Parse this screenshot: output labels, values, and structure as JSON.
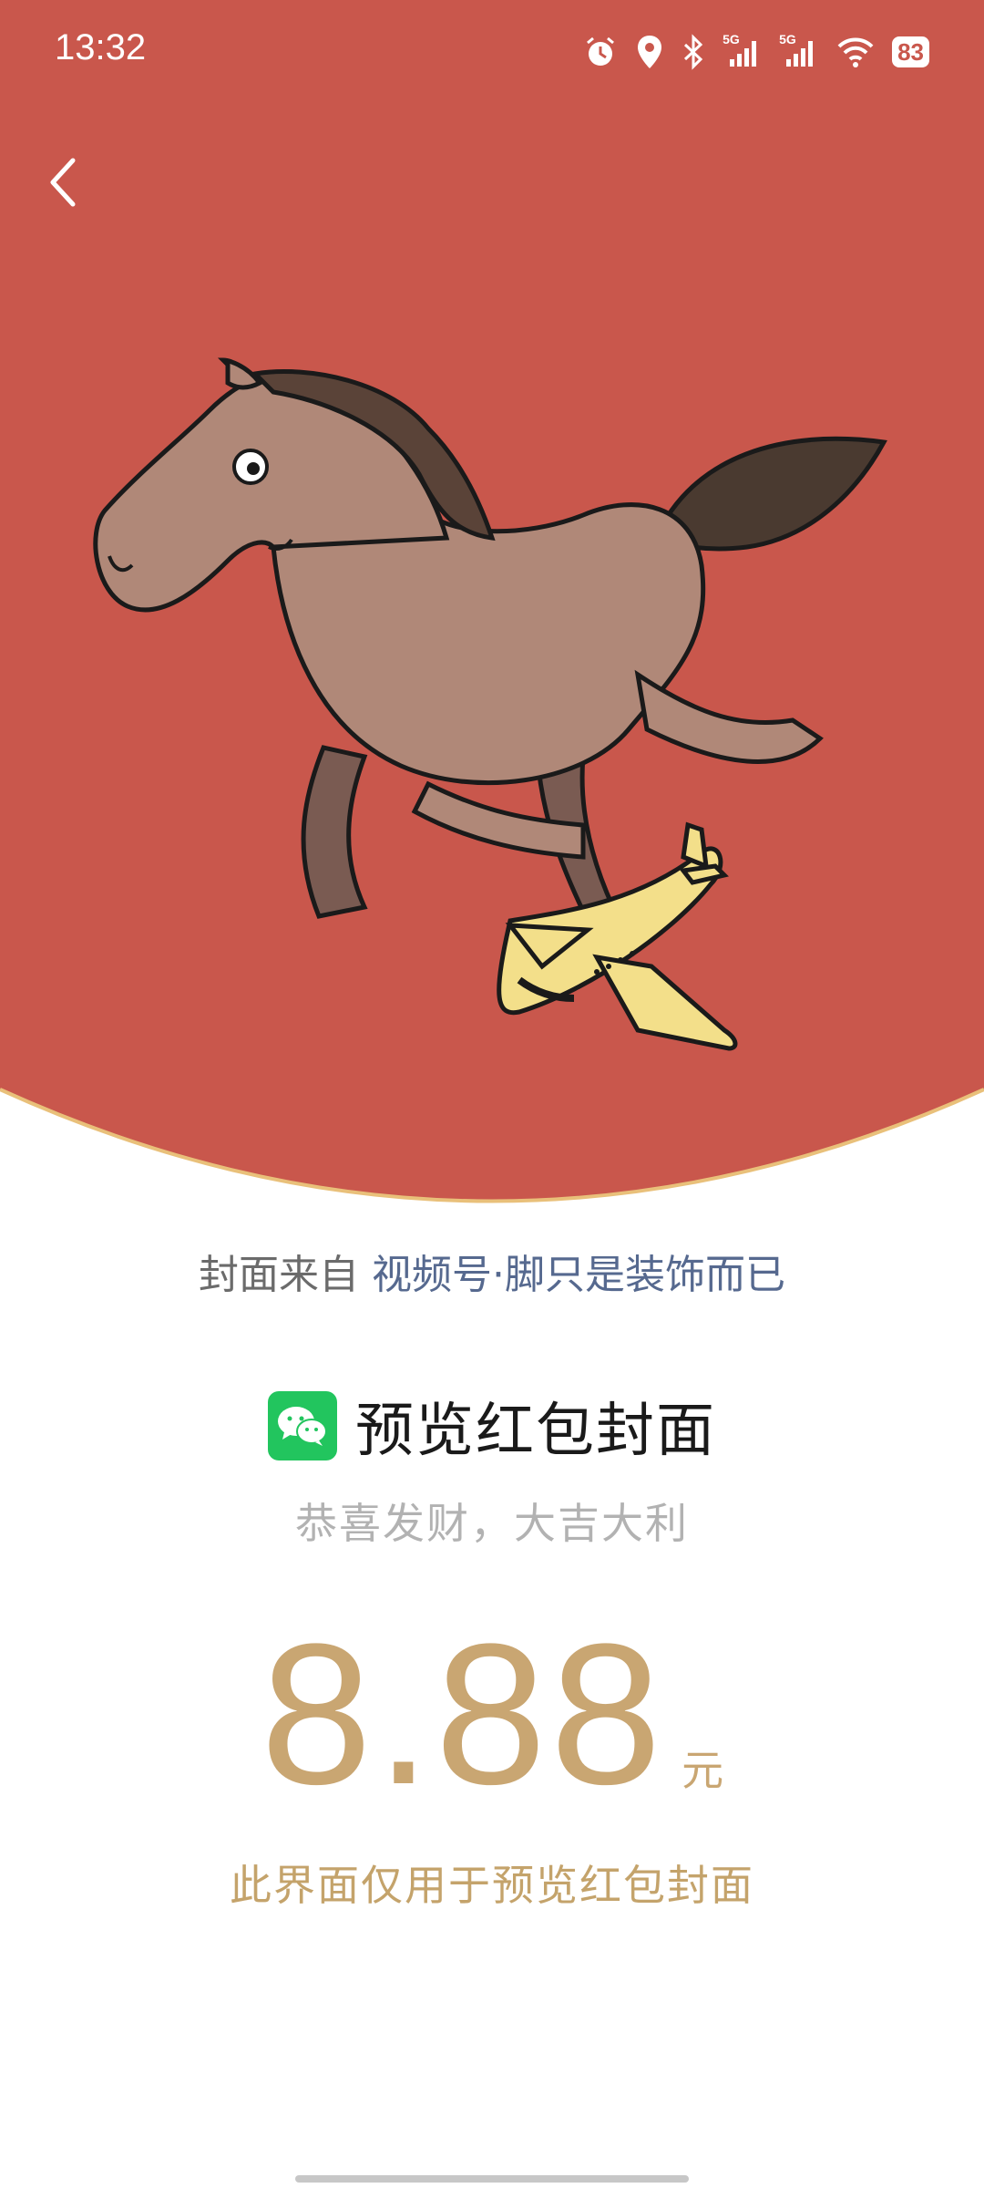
{
  "status_bar": {
    "time": "13:32",
    "battery": "83",
    "signal_1_label": "5G",
    "signal_2_label": "5G"
  },
  "cover": {
    "background_color": "#c9574c",
    "rim_color": "#e9c07a",
    "illustration": "horse-riding-airplane"
  },
  "source": {
    "prefix": "封面来自",
    "channel": "视频号·脚只是装饰而已"
  },
  "title": "预览红包封面",
  "greeting": "恭喜发财，大吉大利",
  "amount": "8.88",
  "unit": "元",
  "note": "此界面仅用于预览红包封面",
  "colors": {
    "accent_gold": "#c9a672",
    "wechat_green": "#22c55e",
    "link_blue": "#56698f"
  }
}
